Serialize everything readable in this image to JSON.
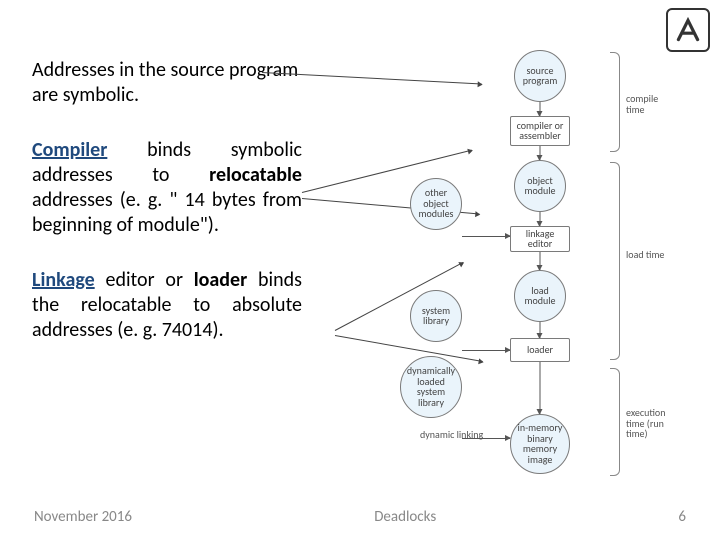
{
  "logo_alt": "institution-logo",
  "paragraphs": {
    "p1": "Addresses in the source program are symbolic.",
    "p2_compiler": "Compiler",
    "p2_mid": " binds symbolic addresses to ",
    "p2_reloc": "relocatable",
    "p2_tail": " addresses (e. g. \" 14 bytes from beginning of module\").",
    "p3_linkage": "Linkage",
    "p3_mid1": " editor or ",
    "p3_loader": "loader",
    "p3_tail": " binds the relocatable to absolute addresses (e. g. 74014)."
  },
  "footer": {
    "date": "November 2016",
    "topic": "Deadlocks",
    "page": "6"
  },
  "diagram": {
    "nodes": {
      "source_program": "source program",
      "compiler_assembler": "compiler or assembler",
      "object_module": "object module",
      "other_object_modules": "other object modules",
      "linkage_editor": "linkage editor",
      "load_module": "load module",
      "system_library": "system library",
      "loader": "loader",
      "dyn_loaded_syslib": "dynamically loaded system library",
      "dynamic_linking": "dynamic linking",
      "in_mem_image": "in-memory binary memory image"
    },
    "braces": {
      "compile_time": "compile time",
      "load_time": "load time",
      "exec_time": "execution time (run time)"
    }
  }
}
